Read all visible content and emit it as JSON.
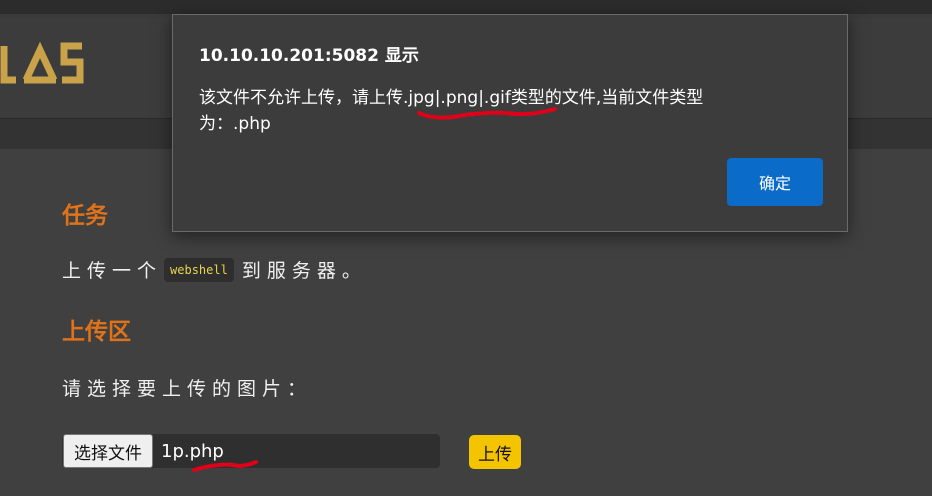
{
  "dialog": {
    "title": "10.10.10.201:5082 显示",
    "message_line1": "该文件不允许上传，请上传.jpg|.png|.gif类型的文件,当前文件类型",
    "message_line2": "为：.php",
    "ok_label": "确定"
  },
  "task": {
    "heading": "任务",
    "text_before": "上传一个",
    "code": "webshell",
    "text_after": "到服务器。"
  },
  "upload": {
    "heading": "上传区",
    "prompt": "请选择要上传的图片：",
    "choose_file_label": "选择文件",
    "file_name": "1p.php",
    "submit_label": "上传"
  },
  "colors": {
    "background": "#404040",
    "heading_orange": "#e0731a",
    "dialog_ok_blue": "#0a6bc8",
    "upload_yellow": "#f5c400",
    "annotation_red": "#e0001a",
    "logo_gold": "#c9a24a"
  },
  "icons": {
    "logo": "site-logo-icon"
  }
}
